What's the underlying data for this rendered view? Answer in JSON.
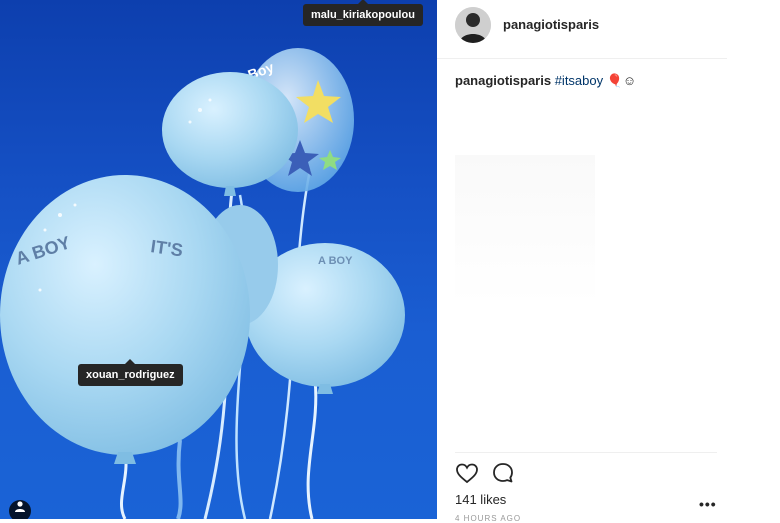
{
  "post": {
    "username": "panagiotisparis",
    "caption_user": "panagiotisparis",
    "caption_hashtag": "#itsaboy",
    "caption_emoji": "🎈☺",
    "likes": "141 likes",
    "more_label": "•••",
    "timestamp": "4 HOURS AGO"
  },
  "photo": {
    "tags": [
      "malu_kiriakopoulou",
      "xouan_rodriguez"
    ],
    "balloon_text": [
      "A BOY",
      "IT'S",
      "A BOY"
    ]
  },
  "icons": {
    "like": "heart-icon",
    "comment": "comment-icon",
    "tag_toggle": "user-tag-icon"
  },
  "colors": {
    "sky": "#1550c4",
    "balloon": "#a9d8f2",
    "tag_bg": "#262626"
  }
}
